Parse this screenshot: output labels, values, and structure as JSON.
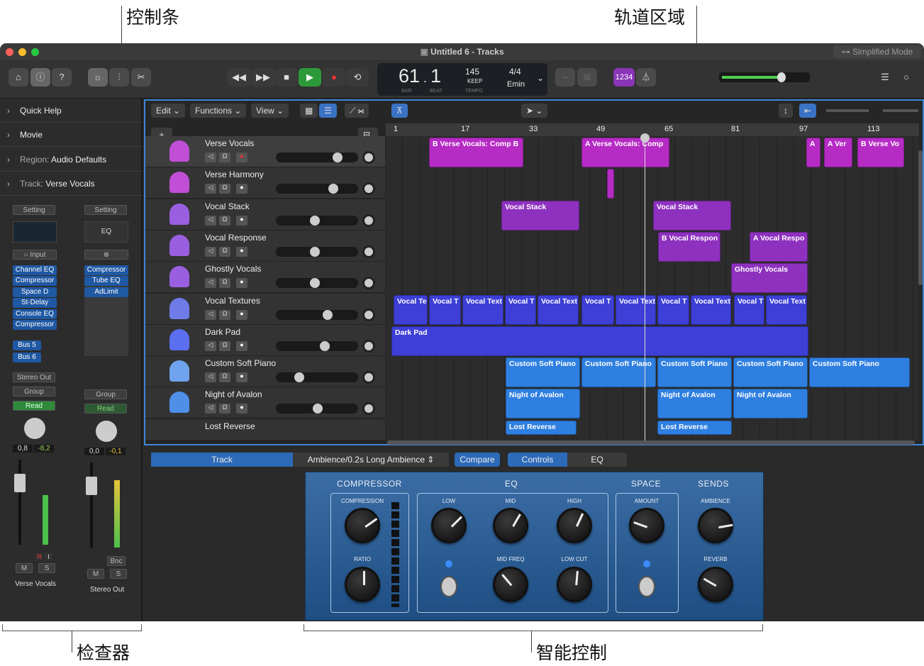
{
  "callouts": {
    "control_bar": "控制条",
    "tracks_area": "轨道区域",
    "inspector": "检查器",
    "smart_controls": "智能控制"
  },
  "window": {
    "title": "Untitled 6 - Tracks",
    "mode": "Simplified Mode"
  },
  "lcd": {
    "bar": "61",
    "beat": "1",
    "bar_label": "BAR",
    "beat_label": "BEAT",
    "tempo": "145",
    "tempo_mode": "KEEP",
    "tempo_label": "TEMPO",
    "sig": "4/4",
    "key": "Emin"
  },
  "count_in": "1234",
  "inspector": {
    "sections": [
      "Quick Help",
      "Movie",
      "Region:",
      "Track:"
    ],
    "region_value": "Audio Defaults",
    "track_value": "Verse Vocals",
    "strip1": {
      "setting": "Setting",
      "input": "Input",
      "plugins": [
        "Channel EQ",
        "Compressor",
        "Space D",
        "St-Delay",
        "Console EQ",
        "Compressor"
      ],
      "sends": [
        "Bus 5",
        "Bus 6"
      ],
      "output": "Stereo Out",
      "group": "Group",
      "auto": "Read",
      "vol": "0,8",
      "pan": "-8,2",
      "r": "R",
      "i": "I",
      "m": "M",
      "s": "S",
      "name": "Verse Vocals"
    },
    "strip2": {
      "setting": "Setting",
      "eq": "EQ",
      "plugins": [
        "Compressor",
        "Tube EQ",
        "AdLimit"
      ],
      "group": "Group",
      "auto": "Read",
      "vol": "0,0",
      "pan": "-0,1",
      "bnc": "Bnc",
      "m": "M",
      "s": "S",
      "name": "Stereo Out"
    }
  },
  "tracks_menu": {
    "edit": "Edit",
    "functions": "Functions",
    "view": "View"
  },
  "ruler": [
    "1",
    "17",
    "33",
    "49",
    "65",
    "81",
    "97",
    "113"
  ],
  "tracks": [
    "Verse Vocals",
    "Verse Harmony",
    "Vocal Stack",
    "Vocal Response",
    "Ghostly Vocals",
    "Vocal Textures",
    "Dark Pad",
    "Custom Soft Piano",
    "Night of Avalon"
  ],
  "regions": {
    "r0": [
      "B  Verse Vocals: Comp B",
      "A  Verse Vocals: Comp",
      "A",
      "A  Ver",
      "B  Verse Vo"
    ],
    "r2": [
      "Vocal Stack",
      "Vocal Stack"
    ],
    "r3": [
      "B  Vocal Respon",
      "A  Vocal Respo"
    ],
    "r4": "Ghostly Vocals",
    "r5": [
      "Vocal Te",
      "Vocal T",
      "Vocal Text",
      "Vocal T",
      "Vocal Text",
      "Vocal T",
      "Vocal Text",
      "Vocal T",
      "Vocal Text",
      "Vocal T",
      "Vocal Text"
    ],
    "r6": "Dark Pad",
    "r7": [
      "Custom Soft Piano",
      "Custom Soft Piano",
      "Custom Soft Piano",
      "Custom Soft Piano",
      "Custom Soft Piano"
    ],
    "r8": [
      "Night of Avalon",
      "Night of Avalon",
      "Night of Avalon"
    ],
    "r9": [
      "Lost Reverse",
      "Lost Reverse"
    ],
    "partial_track": "Lost Reverse"
  },
  "smart": {
    "track": "Track",
    "preset": "Ambience/0.2s Long Ambience",
    "compare": "Compare",
    "controls": "Controls",
    "eq": "EQ",
    "sections": {
      "comp": "COMPRESSOR",
      "eq": "EQ",
      "space": "SPACE",
      "sends": "SENDS"
    },
    "knobs": {
      "compression": "COMPRESSION",
      "ratio": "RATIO",
      "low": "LOW",
      "mid": "MID",
      "high": "HIGH",
      "midfreq": "MID FREQ",
      "lowcut": "LOW CUT",
      "amount": "AMOUNT",
      "ambience": "AMBIENCE",
      "reverb": "REVERB"
    }
  }
}
